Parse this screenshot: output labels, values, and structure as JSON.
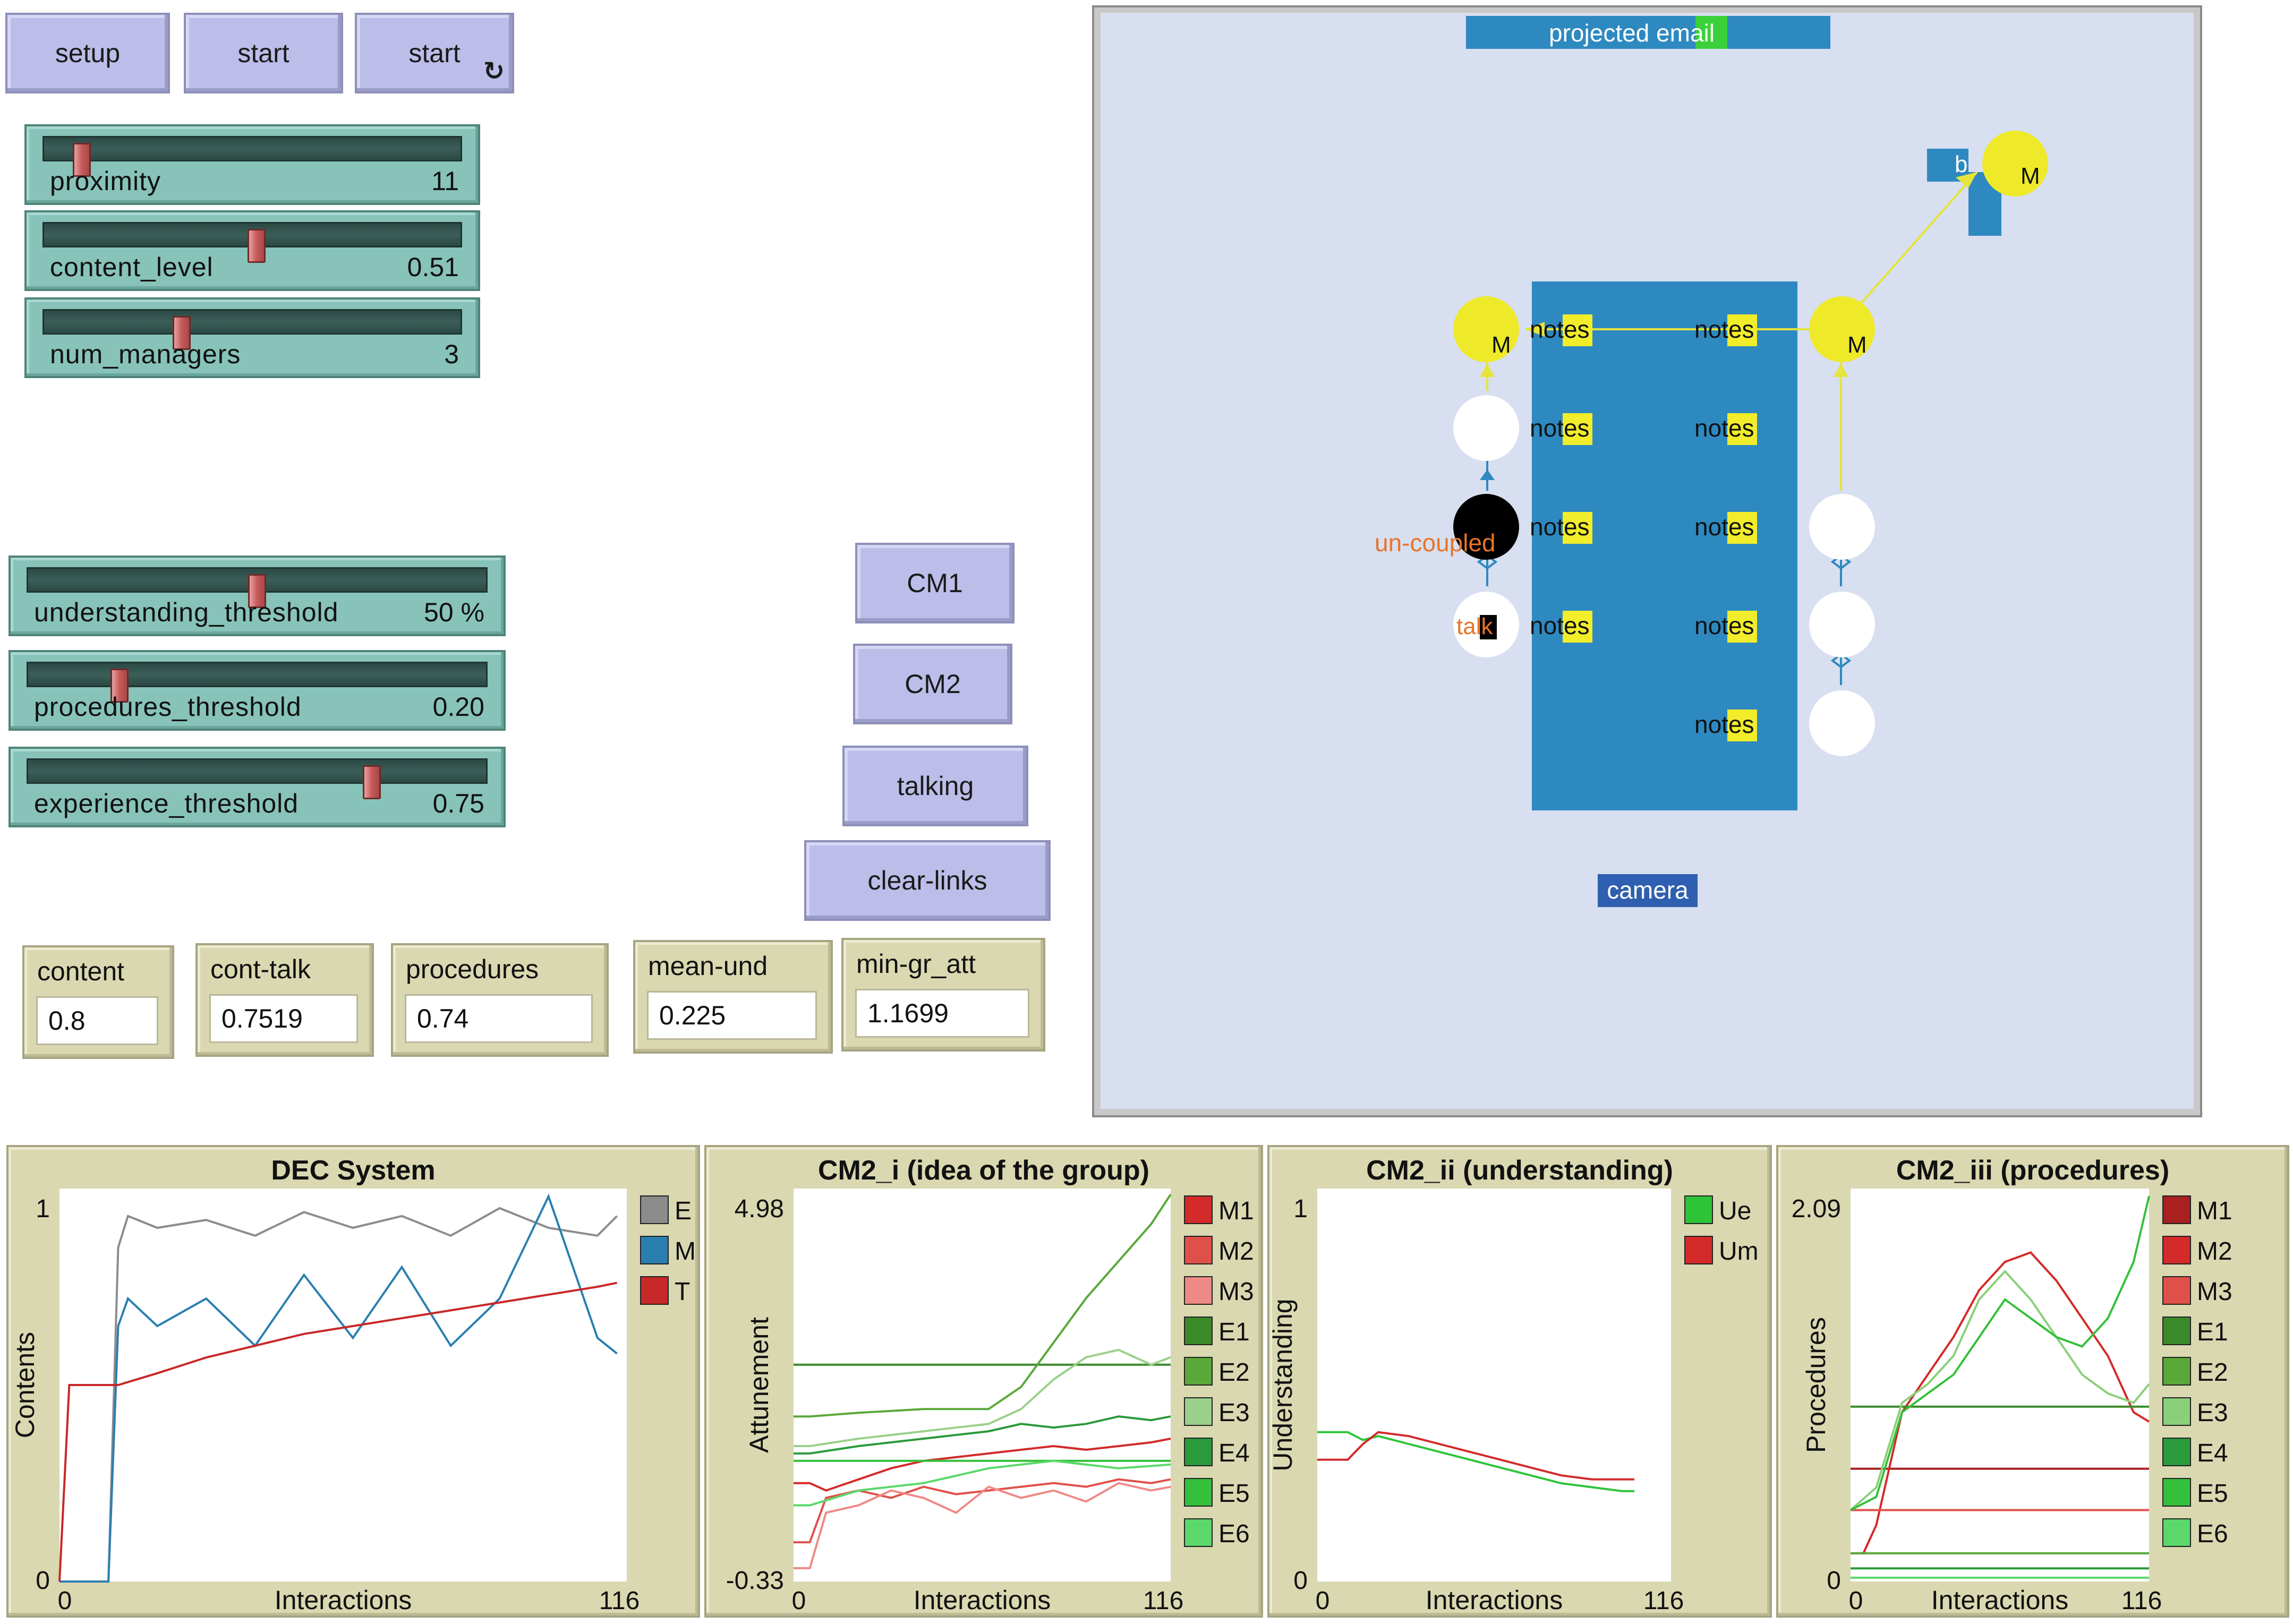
{
  "buttons": {
    "setup": "setup",
    "start": "start",
    "start_forever": "start",
    "cm1": "CM1",
    "cm2": "CM2",
    "talking": "talking",
    "clear_links": "clear-links"
  },
  "sliders": [
    {
      "label": "proximity",
      "value": "11",
      "level": 0.1
    },
    {
      "label": "content_level",
      "value": "0.51",
      "level": 0.51
    },
    {
      "label": "num_managers",
      "value": "3",
      "level": 0.33
    },
    {
      "label": "understanding_threshold",
      "value": "50 %",
      "level": 0.5
    },
    {
      "label": "procedures_threshold",
      "value": "0.20",
      "level": 0.2
    },
    {
      "label": "experience_threshold",
      "value": "0.75",
      "level": 0.75
    }
  ],
  "monitors": [
    {
      "label": "content",
      "value": "0.8"
    },
    {
      "label": "cont-talk",
      "value": "0.7519"
    },
    {
      "label": "procedures",
      "value": "0.74"
    },
    {
      "label": "mean-und",
      "value": "0.225"
    },
    {
      "label": "min-gr_att",
      "value": "1.1699"
    }
  ],
  "world": {
    "projected_label": "projected email",
    "camera_label": "camera",
    "b_label": "b",
    "manager_label": "M",
    "notes_label": "notes",
    "uncoupled_label": "un-coupled",
    "talk_label": "talk"
  },
  "colors": {
    "button": "#bcbde8",
    "slider": "#87c3b8",
    "monitor": "#d9d8b0",
    "world_bg": "#d7dff0",
    "table": "#2e89c0",
    "manager": "#eeea2a",
    "link": "#e6e43a"
  },
  "chart_data": [
    {
      "type": "line",
      "title": "DEC System",
      "xlabel": "Interactions",
      "ylabel": "Contents",
      "xlim": [
        0,
        116
      ],
      "ylim": [
        0,
        1
      ],
      "x_ticks": [
        "0",
        "116"
      ],
      "y_ticks": [
        "0",
        "1"
      ],
      "legend": "right",
      "series": [
        {
          "name": "E",
          "color": "#8c8c8c",
          "x": [
            0,
            10,
            12,
            14,
            20,
            30,
            40,
            50,
            60,
            70,
            80,
            90,
            100,
            110,
            114
          ],
          "y": [
            0,
            0,
            0.85,
            0.93,
            0.9,
            0.92,
            0.88,
            0.94,
            0.9,
            0.93,
            0.88,
            0.95,
            0.9,
            0.88,
            0.93
          ]
        },
        {
          "name": "M",
          "color": "#2a7fb0",
          "x": [
            0,
            10,
            12,
            14,
            20,
            30,
            40,
            50,
            60,
            70,
            80,
            90,
            100,
            110,
            114
          ],
          "y": [
            0,
            0,
            0.65,
            0.72,
            0.65,
            0.72,
            0.6,
            0.78,
            0.62,
            0.8,
            0.6,
            0.72,
            0.98,
            0.62,
            0.58
          ]
        },
        {
          "name": "T",
          "color": "#c82828",
          "x": [
            0,
            2,
            12,
            20,
            30,
            40,
            50,
            60,
            70,
            80,
            90,
            100,
            110,
            114
          ],
          "y": [
            0,
            0.5,
            0.5,
            0.53,
            0.57,
            0.6,
            0.63,
            0.65,
            0.67,
            0.69,
            0.71,
            0.73,
            0.75,
            0.76
          ]
        }
      ]
    },
    {
      "type": "line",
      "title": "CM2_i (idea of the group)",
      "xlabel": "Interactions",
      "ylabel": "Attunement",
      "xlim": [
        0,
        116
      ],
      "ylim": [
        -0.33,
        4.98
      ],
      "x_ticks": [
        "0",
        "116"
      ],
      "y_ticks": [
        "-0.33",
        "4.98"
      ],
      "legend": "right",
      "series": [
        {
          "name": "M1",
          "color": "#d42a2a",
          "x": [
            0,
            5,
            10,
            20,
            30,
            40,
            50,
            60,
            70,
            80,
            90,
            100,
            110,
            116
          ],
          "y": [
            1.0,
            1.0,
            0.9,
            1.05,
            1.2,
            1.3,
            1.35,
            1.4,
            1.45,
            1.5,
            1.45,
            1.5,
            1.55,
            1.6
          ]
        },
        {
          "name": "M2",
          "color": "#e0504a",
          "x": [
            0,
            5,
            10,
            20,
            30,
            40,
            50,
            60,
            70,
            80,
            90,
            100,
            110,
            116
          ],
          "y": [
            0.2,
            0.2,
            0.8,
            0.9,
            0.8,
            0.95,
            0.85,
            0.9,
            0.95,
            1.0,
            0.95,
            1.05,
            1.0,
            1.05
          ]
        },
        {
          "name": "M3",
          "color": "#ee8a86",
          "x": [
            0,
            5,
            10,
            20,
            30,
            40,
            50,
            60,
            70,
            80,
            90,
            100,
            110,
            116
          ],
          "y": [
            -0.15,
            -0.15,
            0.6,
            0.7,
            0.9,
            0.8,
            0.6,
            0.95,
            0.8,
            0.9,
            0.75,
            1.0,
            0.9,
            0.95
          ]
        },
        {
          "name": "E1",
          "color": "#3a8a2a",
          "x": [
            0,
            116
          ],
          "y": [
            2.6,
            2.6
          ]
        },
        {
          "name": "E2",
          "color": "#5aa83a",
          "x": [
            0,
            5,
            20,
            40,
            60,
            70,
            80,
            90,
            100,
            110,
            116
          ],
          "y": [
            1.9,
            1.9,
            1.95,
            2.0,
            2.0,
            2.3,
            2.9,
            3.5,
            4.0,
            4.5,
            4.9
          ]
        },
        {
          "name": "E3",
          "color": "#9ad08a",
          "x": [
            0,
            5,
            20,
            40,
            60,
            70,
            80,
            90,
            100,
            110,
            116
          ],
          "y": [
            1.5,
            1.5,
            1.6,
            1.7,
            1.8,
            2.0,
            2.4,
            2.7,
            2.8,
            2.6,
            2.7
          ]
        },
        {
          "name": "E4",
          "color": "#2a9a3a",
          "x": [
            0,
            5,
            20,
            40,
            60,
            70,
            80,
            90,
            100,
            110,
            116
          ],
          "y": [
            1.4,
            1.4,
            1.5,
            1.6,
            1.7,
            1.8,
            1.75,
            1.8,
            1.9,
            1.85,
            1.9
          ]
        },
        {
          "name": "E5",
          "color": "#34c03a",
          "x": [
            0,
            116
          ],
          "y": [
            1.3,
            1.3
          ]
        },
        {
          "name": "E6",
          "color": "#5ad86a",
          "x": [
            0,
            5,
            20,
            40,
            60,
            80,
            100,
            116
          ],
          "y": [
            0.7,
            0.7,
            0.9,
            1.0,
            1.2,
            1.3,
            1.2,
            1.25
          ]
        }
      ]
    },
    {
      "type": "line",
      "title": "CM2_ii (understanding)",
      "xlabel": "Interactions",
      "ylabel": "Understanding",
      "xlim": [
        0,
        116
      ],
      "ylim": [
        0,
        1
      ],
      "x_ticks": [
        "0",
        "116"
      ],
      "y_ticks": [
        "0",
        "1"
      ],
      "legend": "right",
      "series": [
        {
          "name": "Ue",
          "color": "#2ec43a",
          "x": [
            0,
            10,
            15,
            20,
            30,
            40,
            50,
            60,
            70,
            80,
            90,
            100,
            104
          ],
          "y": [
            0.38,
            0.38,
            0.36,
            0.37,
            0.35,
            0.33,
            0.31,
            0.29,
            0.27,
            0.25,
            0.24,
            0.23,
            0.23
          ]
        },
        {
          "name": "Um",
          "color": "#d42a2a",
          "x": [
            0,
            10,
            15,
            20,
            30,
            40,
            50,
            60,
            70,
            80,
            90,
            100,
            104
          ],
          "y": [
            0.31,
            0.31,
            0.35,
            0.38,
            0.37,
            0.35,
            0.33,
            0.31,
            0.29,
            0.27,
            0.26,
            0.26,
            0.26
          ]
        }
      ]
    },
    {
      "type": "line",
      "title": "CM2_iii (procedures)",
      "xlabel": "Interactions",
      "ylabel": "Procedures",
      "xlim": [
        0,
        116
      ],
      "ylim": [
        0,
        2.09
      ],
      "x_ticks": [
        "0",
        "116"
      ],
      "y_ticks": [
        "0",
        "2.09"
      ],
      "legend": "right",
      "series": [
        {
          "name": "M1",
          "color": "#a82020",
          "x": [
            0,
            116
          ],
          "y": [
            0.6,
            0.6
          ]
        },
        {
          "name": "M2",
          "color": "#d42a2a",
          "x": [
            0,
            5,
            10,
            20,
            30,
            40,
            50,
            60,
            70,
            80,
            90,
            100,
            110,
            116
          ],
          "y": [
            0.15,
            0.15,
            0.3,
            0.9,
            1.1,
            1.3,
            1.55,
            1.7,
            1.75,
            1.6,
            1.4,
            1.2,
            0.9,
            0.85
          ]
        },
        {
          "name": "M3",
          "color": "#e0504a",
          "x": [
            0,
            116
          ],
          "y": [
            0.38,
            0.38
          ]
        },
        {
          "name": "E1",
          "color": "#3a8a2a",
          "x": [
            0,
            116
          ],
          "y": [
            0.93,
            0.93
          ]
        },
        {
          "name": "E2",
          "color": "#5aa83a",
          "x": [
            0,
            116
          ],
          "y": [
            0.15,
            0.15
          ]
        },
        {
          "name": "E3",
          "color": "#8ad07a",
          "x": [
            0,
            10,
            20,
            30,
            40,
            50,
            60,
            70,
            80,
            90,
            100,
            110,
            116
          ],
          "y": [
            0.38,
            0.5,
            0.95,
            1.05,
            1.2,
            1.5,
            1.65,
            1.5,
            1.3,
            1.1,
            1.0,
            0.95,
            1.05
          ]
        },
        {
          "name": "E4",
          "color": "#2a9a3a",
          "x": [
            0,
            116
          ],
          "y": [
            0.07,
            0.07
          ]
        },
        {
          "name": "E5",
          "color": "#34c03a",
          "x": [
            0,
            10,
            20,
            30,
            40,
            50,
            60,
            70,
            80,
            90,
            100,
            110,
            116
          ],
          "y": [
            0.38,
            0.45,
            0.9,
            1.0,
            1.1,
            1.3,
            1.5,
            1.4,
            1.3,
            1.25,
            1.4,
            1.7,
            2.05
          ]
        },
        {
          "name": "E6",
          "color": "#5ad86a",
          "x": [
            0,
            116
          ],
          "y": [
            0.02,
            0.02
          ]
        }
      ]
    }
  ]
}
